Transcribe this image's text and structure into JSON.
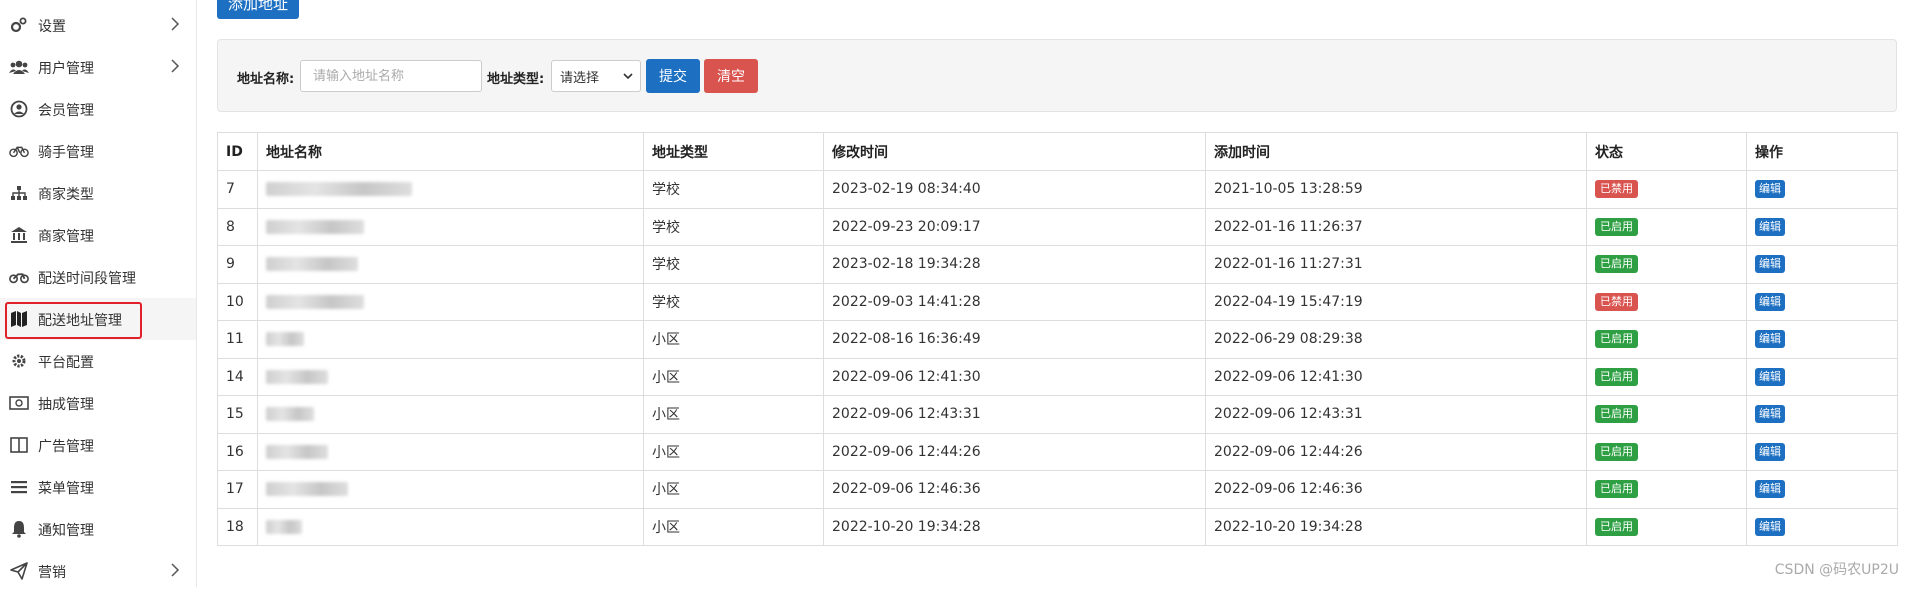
{
  "sidebar": {
    "items": [
      {
        "label": "设置",
        "icon": "gears-icon",
        "has_arrow": true
      },
      {
        "label": "用户管理",
        "icon": "users-icon",
        "has_arrow": true
      },
      {
        "label": "会员管理",
        "icon": "user-circle-icon",
        "has_arrow": false
      },
      {
        "label": "骑手管理",
        "icon": "bicycle-icon",
        "has_arrow": false
      },
      {
        "label": "商家类型",
        "icon": "sitemap-icon",
        "has_arrow": false
      },
      {
        "label": "商家管理",
        "icon": "bank-icon",
        "has_arrow": false
      },
      {
        "label": "配送时间段管理",
        "icon": "motorcycle-icon",
        "has_arrow": false
      },
      {
        "label": "配送地址管理",
        "icon": "map-icon",
        "has_arrow": false,
        "active": true
      },
      {
        "label": "平台配置",
        "icon": "cog-icon",
        "has_arrow": false
      },
      {
        "label": "抽成管理",
        "icon": "money-icon",
        "has_arrow": false
      },
      {
        "label": "广告管理",
        "icon": "columns-icon",
        "has_arrow": false
      },
      {
        "label": "菜单管理",
        "icon": "bars-icon",
        "has_arrow": false
      },
      {
        "label": "通知管理",
        "icon": "bell-icon",
        "has_arrow": false
      },
      {
        "label": "营销",
        "icon": "paper-plane-icon",
        "has_arrow": true
      }
    ]
  },
  "toolbar": {
    "add_label": "添加地址"
  },
  "filter": {
    "name_label": "地址名称:",
    "name_placeholder": "请输入地址名称",
    "type_label": "地址类型:",
    "type_selected": "请选择",
    "submit_label": "提交",
    "clear_label": "清空"
  },
  "table": {
    "headers": [
      "ID",
      "地址名称",
      "地址类型",
      "修改时间",
      "添加时间",
      "状态",
      "操作"
    ],
    "rows": [
      {
        "id": "7",
        "type": "学校",
        "modified": "2023-02-19 08:34:40",
        "added": "2021-10-05 13:28:59",
        "status": "已禁用",
        "status_color": "red",
        "action": "编辑"
      },
      {
        "id": "8",
        "type": "学校",
        "modified": "2022-09-23 20:09:17",
        "added": "2022-01-16 11:26:37",
        "status": "已启用",
        "status_color": "green",
        "action": "编辑"
      },
      {
        "id": "9",
        "type": "学校",
        "modified": "2023-02-18 19:34:28",
        "added": "2022-01-16 11:27:31",
        "status": "已启用",
        "status_color": "green",
        "action": "编辑"
      },
      {
        "id": "10",
        "type": "学校",
        "modified": "2022-09-03 14:41:28",
        "added": "2022-04-19 15:47:19",
        "status": "已禁用",
        "status_color": "red",
        "action": "编辑"
      },
      {
        "id": "11",
        "type": "小区",
        "modified": "2022-08-16 16:36:49",
        "added": "2022-06-29 08:29:38",
        "status": "已启用",
        "status_color": "green",
        "action": "编辑"
      },
      {
        "id": "14",
        "type": "小区",
        "modified": "2022-09-06 12:41:30",
        "added": "2022-09-06 12:41:30",
        "status": "已启用",
        "status_color": "green",
        "action": "编辑"
      },
      {
        "id": "15",
        "type": "小区",
        "modified": "2022-09-06 12:43:31",
        "added": "2022-09-06 12:43:31",
        "status": "已启用",
        "status_color": "green",
        "action": "编辑"
      },
      {
        "id": "16",
        "type": "小区",
        "modified": "2022-09-06 12:44:26",
        "added": "2022-09-06 12:44:26",
        "status": "已启用",
        "status_color": "green",
        "action": "编辑"
      },
      {
        "id": "17",
        "type": "小区",
        "modified": "2022-09-06 12:46:36",
        "added": "2022-09-06 12:46:36",
        "status": "已启用",
        "status_color": "green",
        "action": "编辑"
      },
      {
        "id": "18",
        "type": "小区",
        "modified": "2022-10-20 19:34:28",
        "added": "2022-10-20 19:34:28",
        "status": "已启用",
        "status_color": "green",
        "action": "编辑"
      }
    ]
  },
  "watermark": "CSDN @码农UP2U",
  "colors": {
    "primary": "#1d6fc2",
    "danger": "#d9534f",
    "success": "#2ea043",
    "highlight": "#e0202a"
  }
}
